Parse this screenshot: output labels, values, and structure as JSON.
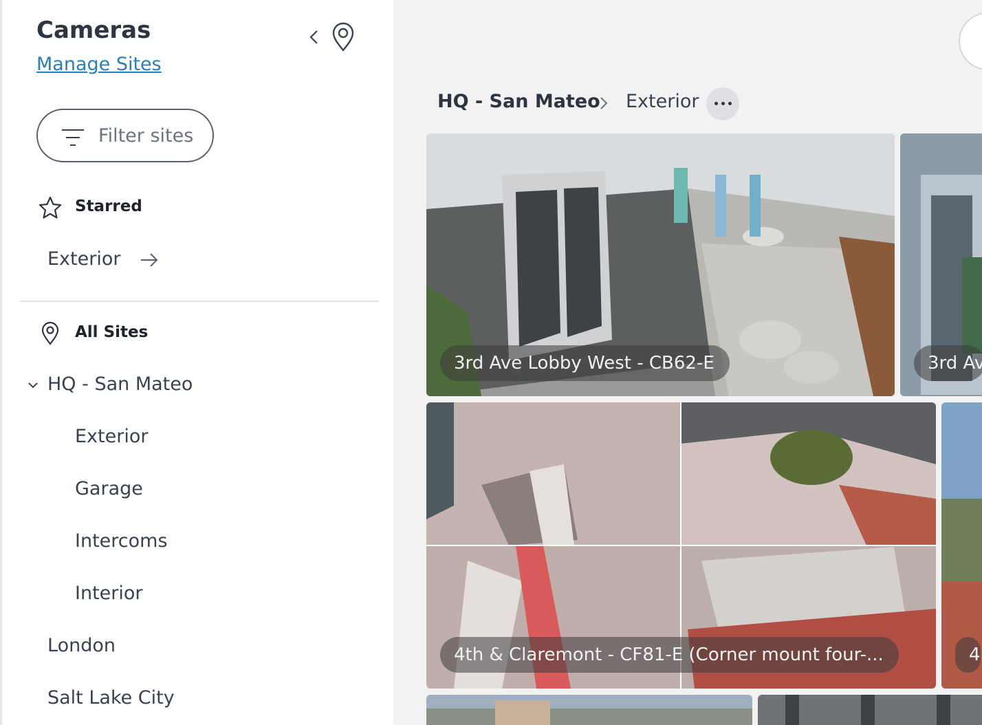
{
  "sidebar": {
    "title": "Cameras",
    "manage_link": "Manage Sites",
    "filter_placeholder": "Filter sites",
    "starred_label": "Starred",
    "starred_items": [
      "Exterior"
    ],
    "all_sites_label": "All Sites",
    "site_group": {
      "name": "HQ - San Mateo",
      "children": [
        "Exterior",
        "Garage",
        "Intercoms",
        "Interior"
      ]
    },
    "other_sites": [
      "London",
      "Salt Lake City"
    ]
  },
  "breadcrumb": {
    "site": "HQ - San Mateo",
    "folder": "Exterior"
  },
  "cameras": [
    {
      "name": "3rd Ave Lobby West - CB62-E"
    },
    {
      "name": "3rd Av"
    },
    {
      "name": "4th & Claremont - CF81-E (Corner mount four-..."
    },
    {
      "name": "4"
    }
  ],
  "colors": {
    "accent_link": "#2a7fb5",
    "sidebar_bg": "#ffffff",
    "main_bg": "#f2f2f3"
  }
}
